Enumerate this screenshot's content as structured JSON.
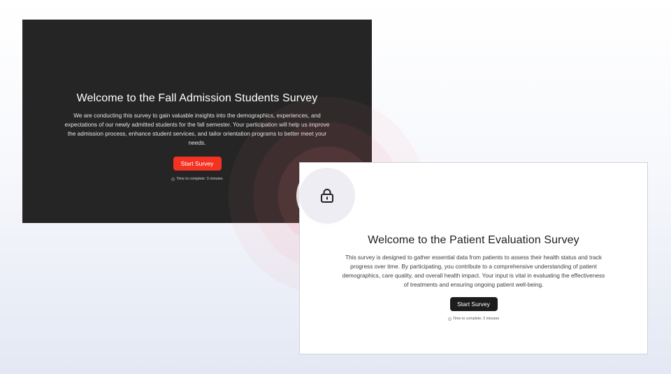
{
  "fall_survey": {
    "title": "Welcome to the Fall Admission Students Survey",
    "description": "We are conducting this survey to gain valuable insights into the demographics, experiences, and expectations of our newly admitted students for the fall semester. Your participation will help us improve the admission process, enhance student services, and tailor orientation programs to better meet your needs.",
    "start_label": "Start Survey",
    "time_text": "Time to complete: 3 minutes",
    "background_color": "#252525",
    "button_color": "#f43222"
  },
  "patient_survey": {
    "title": "Welcome to the Patient Evaluation Survey",
    "description": "This survey is designed to gather essential data from patients to assess their health status and track progress over time. By participating, you contribute to a comprehensive understanding of patient demographics, care quality, and overall health impact. Your input is vital in evaluating the effectiveness of treatments and ensuring ongoing patient well-being.",
    "start_label": "Start Survey",
    "time_text": "Time to complete: 2 minutes",
    "background_color": "#ffffff",
    "button_color": "#1c1c1c"
  },
  "overlay": {
    "icon": "lock-icon",
    "ring_color": "#ee727e"
  }
}
